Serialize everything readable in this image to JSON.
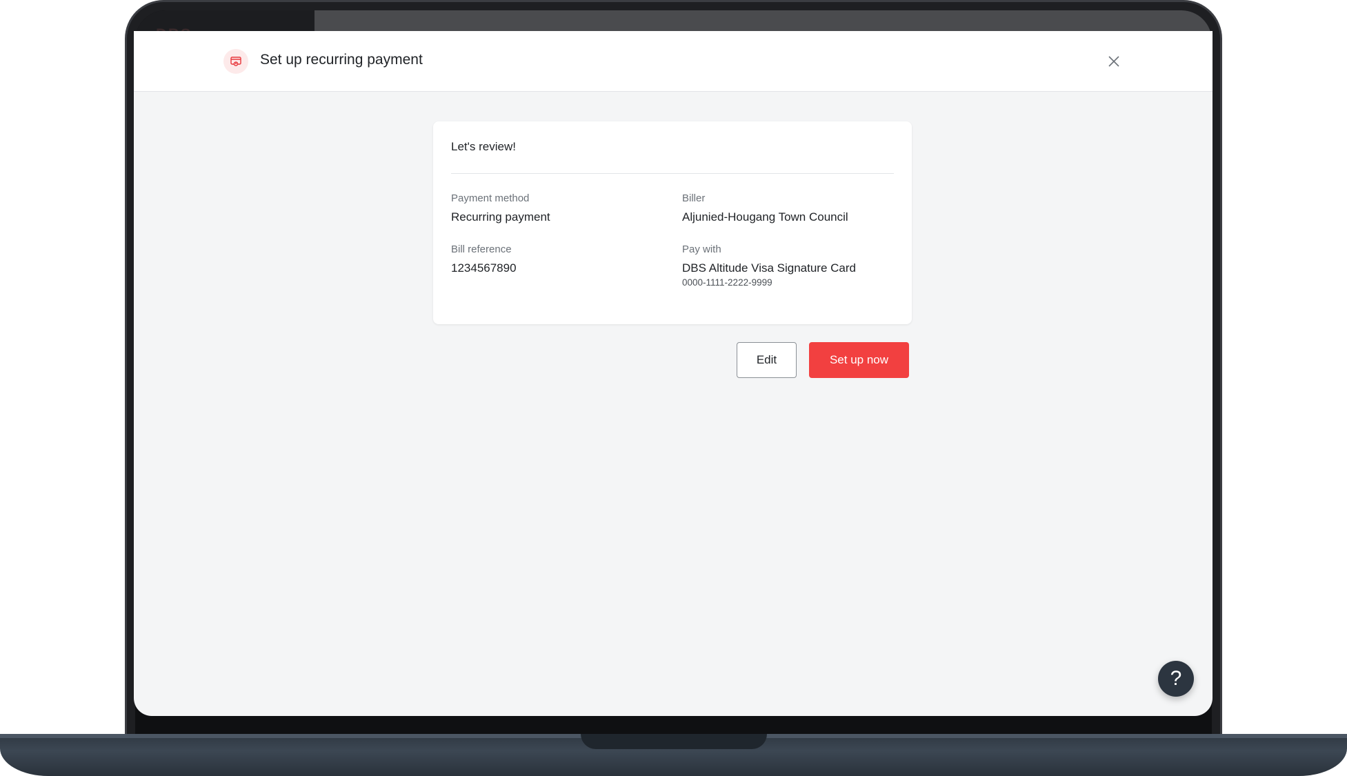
{
  "background_app": {
    "logo_text": "DBS"
  },
  "modal": {
    "title": "Set up recurring payment",
    "icon": "payment-card-icon",
    "close_icon": "close-icon"
  },
  "review": {
    "heading": "Let's review!",
    "fields": [
      {
        "label": "Payment method",
        "value": "Recurring payment"
      },
      {
        "label": "Biller",
        "value": "Aljunied-Hougang Town Council"
      },
      {
        "label": "Bill reference",
        "value": "1234567890"
      },
      {
        "label": "Pay with",
        "value": "DBS Altitude Visa Signature Card",
        "sub": "0000-1111-2222-9999"
      }
    ]
  },
  "actions": {
    "edit_label": "Edit",
    "confirm_label": "Set up now"
  },
  "help": {
    "label": "?"
  },
  "colors": {
    "accent": "#f24040",
    "help_button": "#2c3540",
    "background": "#f4f5f6"
  }
}
